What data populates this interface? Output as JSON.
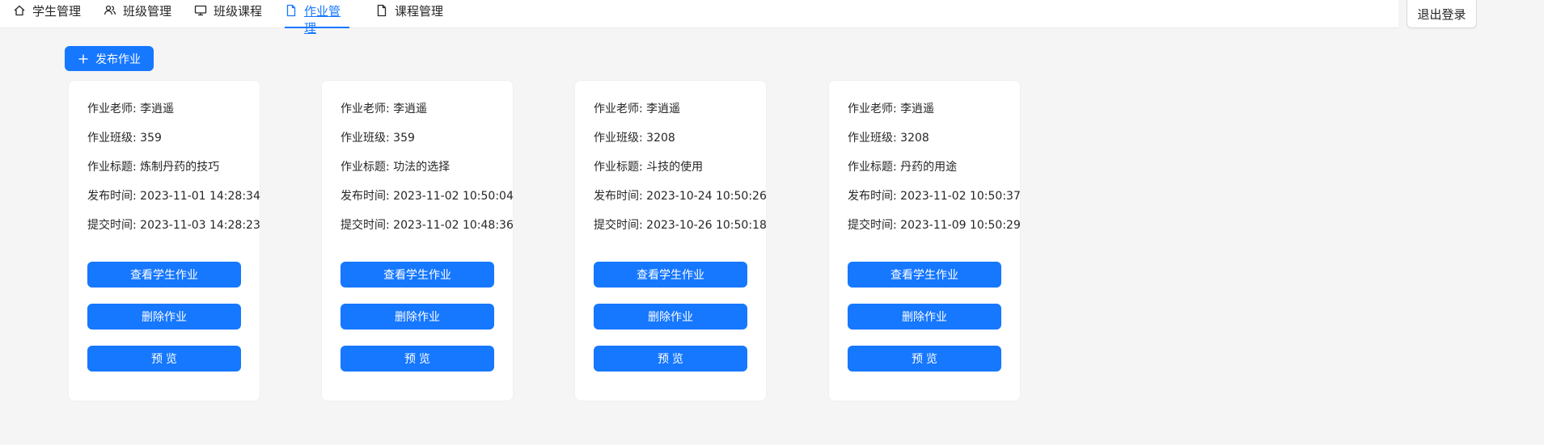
{
  "nav": {
    "items": [
      {
        "label": "学生管理",
        "icon": "home-icon"
      },
      {
        "label": "班级管理",
        "icon": "team-icon"
      },
      {
        "label": "班级课程",
        "icon": "desktop-icon"
      },
      {
        "label": "作业管理",
        "icon": "file-icon",
        "active": true
      },
      {
        "label": "课程管理",
        "icon": "file-icon"
      }
    ],
    "logout_label": "退出登录"
  },
  "toolbar": {
    "publish_label": "发布作业"
  },
  "labels": {
    "teacher": "作业老师: ",
    "class": "作业班级: ",
    "title": "作业标题: ",
    "publish_time": "发布时间: ",
    "submit_time": "提交时间: ",
    "view_btn": "查看学生作业",
    "delete_btn": "删除作业",
    "preview_btn": "预 览"
  },
  "homeworks": [
    {
      "teacher": "李逍遥",
      "class": "359",
      "title": "炼制丹药的技巧",
      "publish_time": "2023-11-01 14:28:34",
      "submit_time": "2023-11-03 14:28:23"
    },
    {
      "teacher": "李逍遥",
      "class": "359",
      "title": "功法的选择",
      "publish_time": "2023-11-02 10:50:04",
      "submit_time": "2023-11-02 10:48:36"
    },
    {
      "teacher": "李逍遥",
      "class": "3208",
      "title": "斗技的使用",
      "publish_time": "2023-10-24 10:50:26",
      "submit_time": "2023-10-26 10:50:18"
    },
    {
      "teacher": "李逍遥",
      "class": "3208",
      "title": "丹药的用途",
      "publish_time": "2023-11-02 10:50:37",
      "submit_time": "2023-11-09 10:50:29"
    }
  ],
  "colors": {
    "accent": "#1677ff",
    "background": "#f5f5f5",
    "card": "#ffffff"
  }
}
